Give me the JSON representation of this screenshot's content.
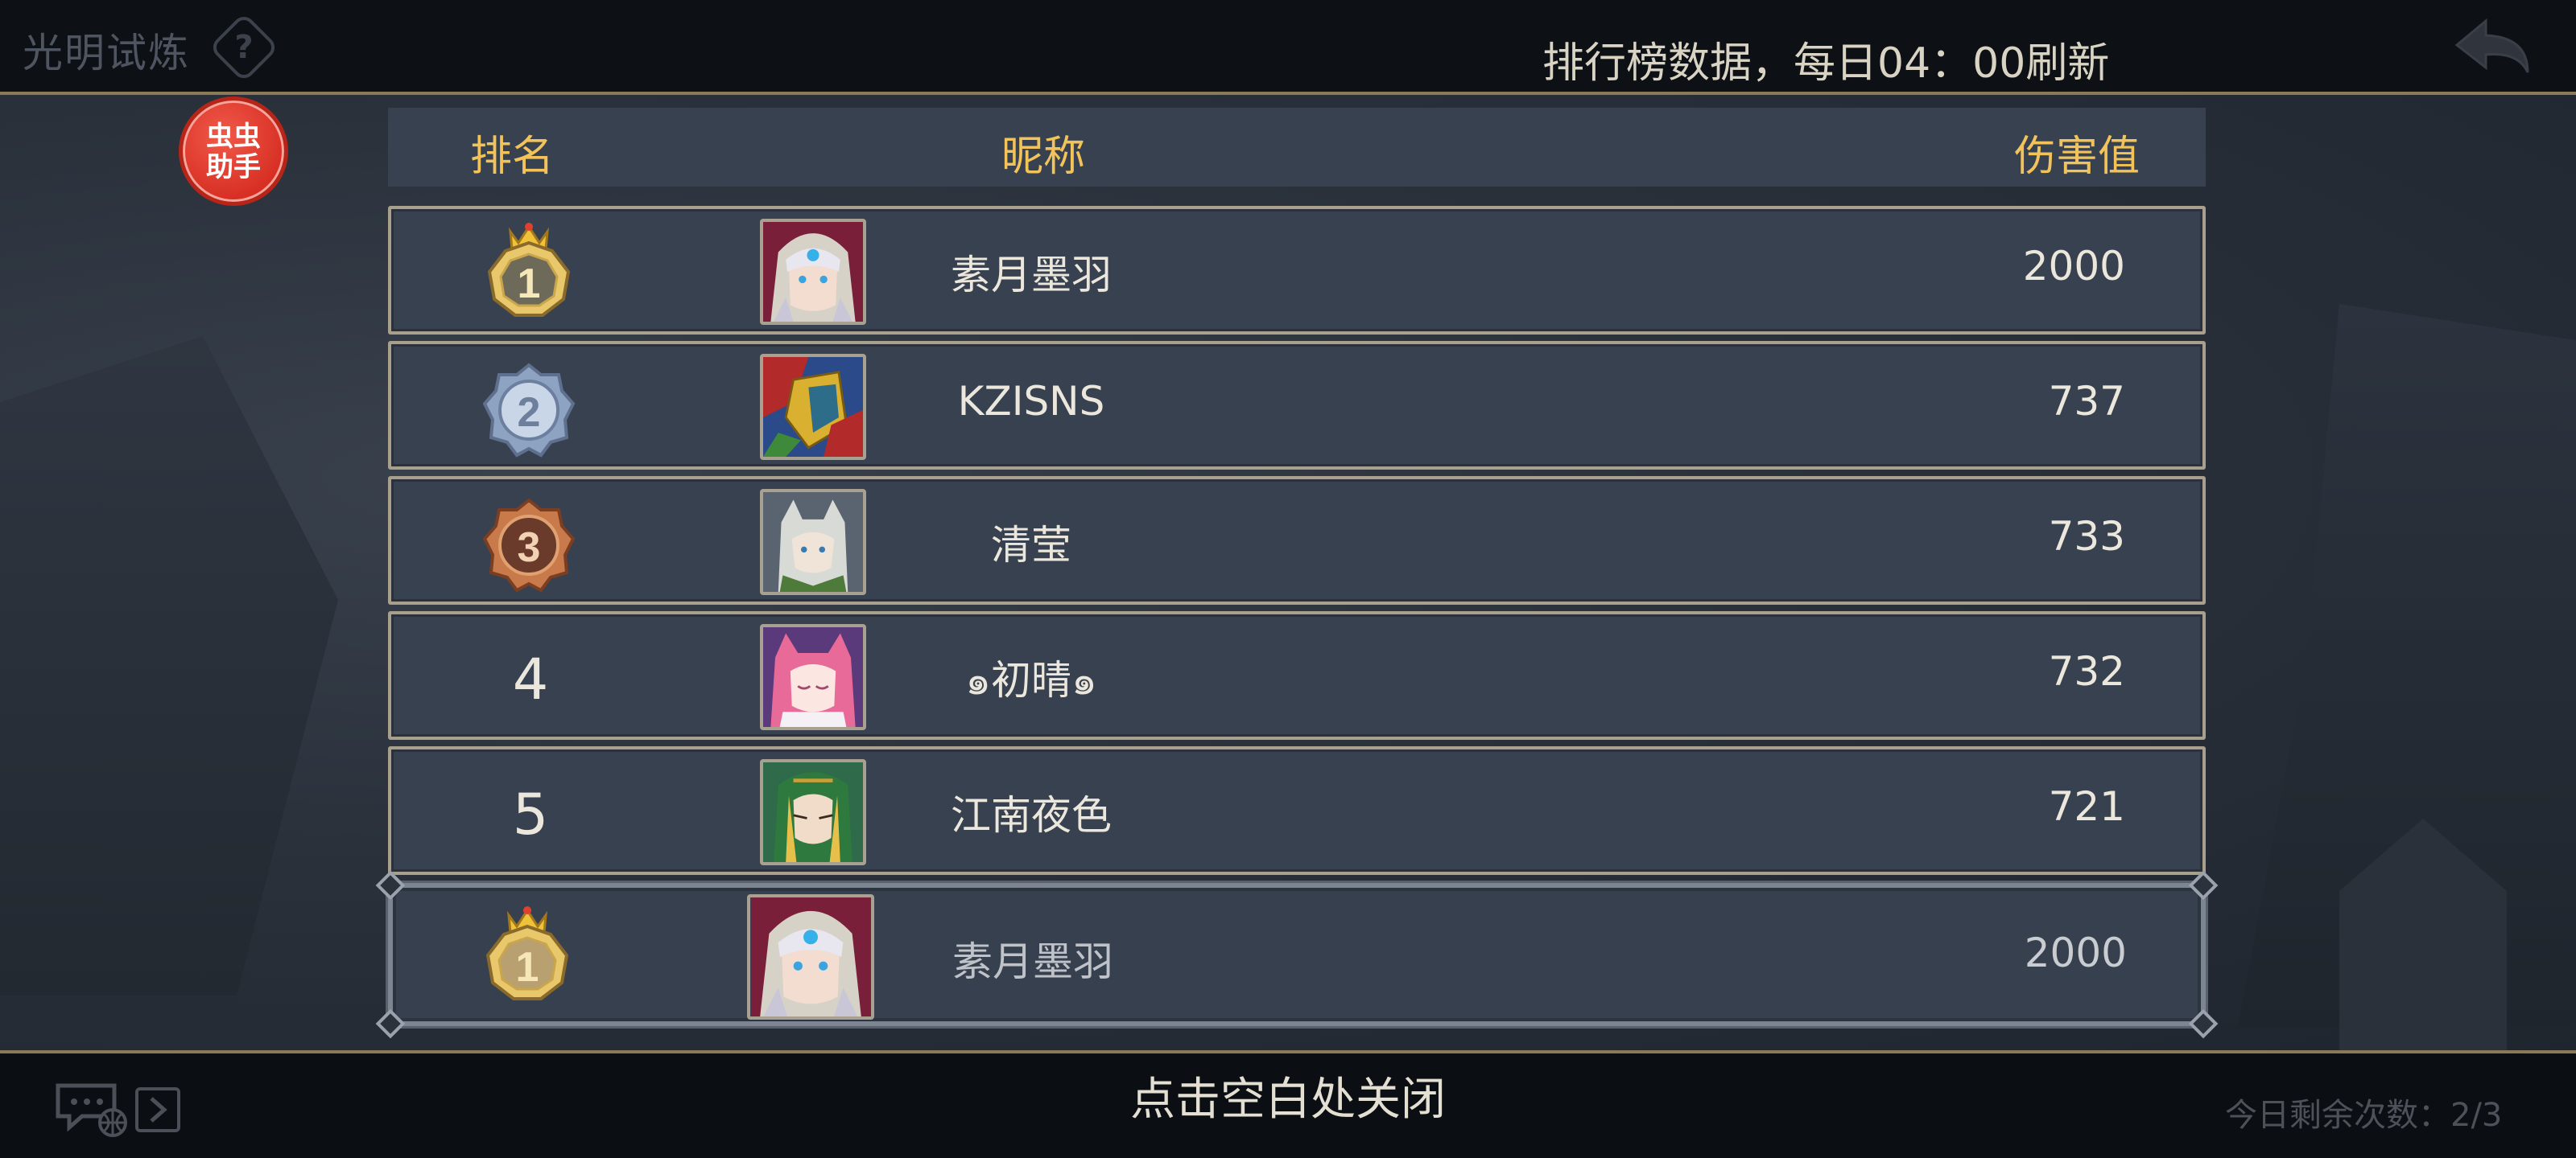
{
  "header": {
    "game_title": "光明试炼",
    "help_icon": "question-diamond-icon",
    "refresh_note": "排行榜数据，每日04：00刷新",
    "back_icon": "return-arrow-icon"
  },
  "assistant_badge": "虫虫\n助手",
  "leaderboard": {
    "columns": {
      "rank": "排名",
      "name": "昵称",
      "damage": "伤害值"
    },
    "rows": [
      {
        "rank": "1",
        "rank_style": "gold-crown-medal",
        "name": "素月墨羽",
        "damage": "2000",
        "avatar": "hooded-white-hair-avatar"
      },
      {
        "rank": "2",
        "rank_style": "silver-medal",
        "name": "KZISNS",
        "damage": "737",
        "avatar": "red-blue-armor-avatar"
      },
      {
        "rank": "3",
        "rank_style": "bronze-medal",
        "name": "清莹",
        "damage": "733",
        "avatar": "wolf-hood-avatar"
      },
      {
        "rank": "4",
        "rank_style": "plain",
        "name": "๑初晴๑",
        "damage": "732",
        "avatar": "pink-hair-catgirl-avatar"
      },
      {
        "rank": "5",
        "rank_style": "plain",
        "name": "江南夜色",
        "damage": "721",
        "avatar": "green-hood-blonde-avatar"
      }
    ],
    "self": {
      "rank": "1",
      "rank_style": "gold-crown-medal",
      "name": "素月墨羽",
      "damage": "2000",
      "avatar": "hooded-white-hair-avatar"
    }
  },
  "footer": {
    "close_hint": "点击空白处关闭",
    "remaining": "今日剩余次数：2/3",
    "chat_icon": "chat-globe-icon",
    "expand_icon": "chevron-right-icon"
  },
  "colors": {
    "header_text": "#f2c35a",
    "row_bg": "#38414f",
    "gold": "#e8c86a",
    "silver": "#9fb2cc",
    "bronze": "#a8694a"
  }
}
